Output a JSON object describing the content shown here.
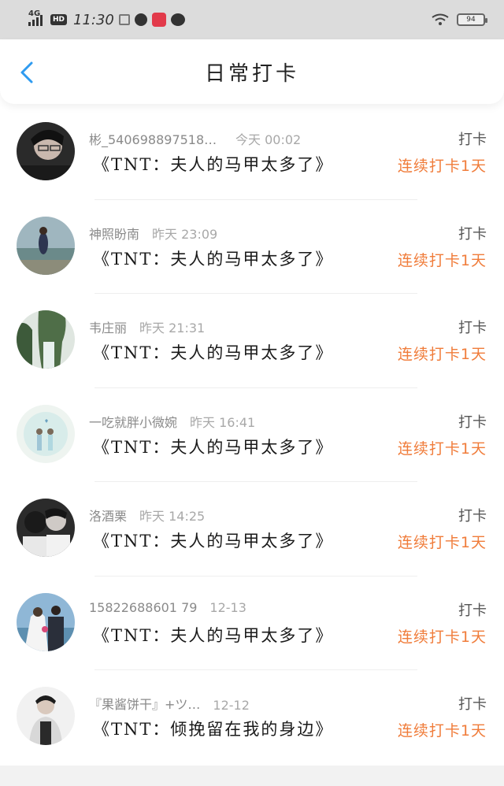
{
  "status_bar": {
    "network": "4G",
    "hd_label": "HD",
    "time": "11:30",
    "battery": "94",
    "icons": [
      "signal-icon",
      "hd-icon",
      "screenshot-icon",
      "app-icon",
      "red-app-icon",
      "wechat-icon",
      "wifi-icon",
      "battery-icon"
    ]
  },
  "header": {
    "title": "日常打卡",
    "back_icon": "chevron-left-icon"
  },
  "colors": {
    "accent_blue": "#2f9bf0",
    "streak_orange": "#f07c3a"
  },
  "entries": [
    {
      "user": "彬_5406988975180…",
      "time": "今天 00:02",
      "book": "《TNT：夫人的马甲太多了》",
      "tag": "打卡",
      "streak": "连续打卡1天",
      "avatar": "avatar-1"
    },
    {
      "user": "神照盼南",
      "time": "昨天 23:09",
      "book": "《TNT：夫人的马甲太多了》",
      "tag": "打卡",
      "streak": "连续打卡1天",
      "avatar": "avatar-2"
    },
    {
      "user": "韦庄丽",
      "time": "昨天 21:31",
      "book": "《TNT：夫人的马甲太多了》",
      "tag": "打卡",
      "streak": "连续打卡1天",
      "avatar": "avatar-3"
    },
    {
      "user": "一吃就胖小微婉",
      "time": "昨天 16:41",
      "book": "《TNT：夫人的马甲太多了》",
      "tag": "打卡",
      "streak": "连续打卡1天",
      "avatar": "avatar-4"
    },
    {
      "user": "洛酒栗",
      "time": "昨天 14:25",
      "book": "《TNT：夫人的马甲太多了》",
      "tag": "打卡",
      "streak": "连续打卡1天",
      "avatar": "avatar-5"
    },
    {
      "user": "15822688601 79",
      "time": "12-13",
      "book": "《TNT：夫人的马甲太多了》",
      "tag": "打卡",
      "streak": "连续打卡1天",
      "avatar": "avatar-6"
    },
    {
      "user": "『果酱饼干』+ツ…",
      "time": "12-12",
      "book": "《TNT：倾挽留在我的身边》",
      "tag": "打卡",
      "streak": "连续打卡1天",
      "avatar": "avatar-7"
    }
  ]
}
